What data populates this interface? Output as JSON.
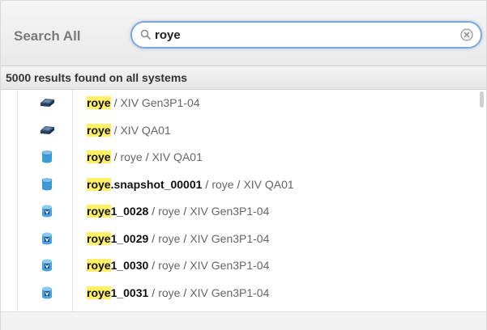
{
  "search": {
    "label": "Search All",
    "query": "roye"
  },
  "results": {
    "count_text": "5000 results found on all systems",
    "items": [
      {
        "icon": "system-icon",
        "highlight": "roye",
        "rest": "",
        "path": [
          "XIV Gen3P1-04"
        ]
      },
      {
        "icon": "system-icon",
        "highlight": "roye",
        "rest": "",
        "path": [
          "XIV QA01"
        ]
      },
      {
        "icon": "pool-icon",
        "highlight": "roye",
        "rest": "",
        "path": [
          "roye",
          "XIV QA01"
        ]
      },
      {
        "icon": "pool-icon",
        "highlight": "roye",
        "rest": ".snapshot_00001",
        "path": [
          "roye",
          "XIV QA01"
        ]
      },
      {
        "icon": "volume-icon",
        "highlight": "roye",
        "rest": "1_0028",
        "path": [
          "roye",
          "XIV Gen3P1-04"
        ]
      },
      {
        "icon": "volume-icon",
        "highlight": "roye",
        "rest": "1_0029",
        "path": [
          "roye",
          "XIV Gen3P1-04"
        ]
      },
      {
        "icon": "volume-icon",
        "highlight": "roye",
        "rest": "1_0030",
        "path": [
          "roye",
          "XIV Gen3P1-04"
        ]
      },
      {
        "icon": "volume-icon",
        "highlight": "roye",
        "rest": "1_0031",
        "path": [
          "roye",
          "XIV Gen3P1-04"
        ]
      }
    ],
    "separator": "/"
  },
  "colors": {
    "highlight": "#fff066",
    "search_border": "#7fa8d8"
  }
}
